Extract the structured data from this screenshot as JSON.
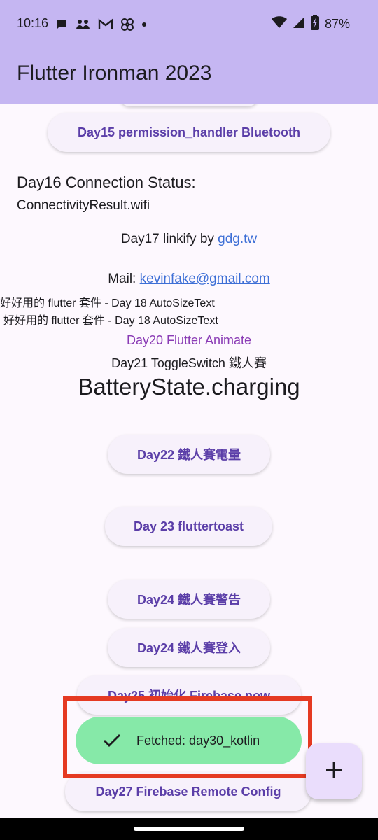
{
  "status_bar": {
    "time": "10:16",
    "battery_percent": "87%",
    "icons": [
      "chat-bubble-icon",
      "people-icon",
      "gmail-icon",
      "pinwheel-icon",
      "dot-icon",
      "wifi-icon",
      "signal-icon",
      "battery-charging-icon"
    ]
  },
  "app_bar": {
    "title": "Flutter Ironman 2023"
  },
  "main": {
    "day15_button": "Day15 permission_handler Bluetooth",
    "day16_label": "Day16 Connection Status:",
    "day16_value": "ConnectivityResult.wifi",
    "day17_prefix": "Day17 linkify by ",
    "day17_link": "gdg.tw",
    "mail_prefix": "Mail: ",
    "mail_link": "kevinfake@gmail.com",
    "autosize_line1": "好好用的 flutter 套件 - Day 18 AutoSizeText",
    "autosize_line2": "好好用的 flutter 套件 - Day 18 AutoSizeText",
    "day20_text": "Day20 Flutter Animate",
    "day21_text": "Day21 ToggleSwitch 鐵人賽",
    "battery_state": "BatteryState.charging",
    "day22_button": "Day22 鐵人賽電量",
    "day23_button": "Day 23 fluttertoast",
    "day24_alert_button": "Day24 鐵人賽警告",
    "day24_login_button": "Day24 鐵人賽登入",
    "day25_button": "Day25 初始化 Firebase now",
    "day27_button": "Day27 Firebase Remote Config"
  },
  "snackbar": {
    "message": "Fetched: day30_kotlin"
  },
  "fab": {
    "icon": "plus-icon"
  },
  "colors": {
    "app_bar": "#c5b6f2",
    "background": "#fdf8fe",
    "button_text": "#5b3ea8",
    "snackbar": "#86e9a8",
    "highlight": "#e53a22",
    "link": "#3d6fd6",
    "animate_text": "#8a3bb5"
  }
}
